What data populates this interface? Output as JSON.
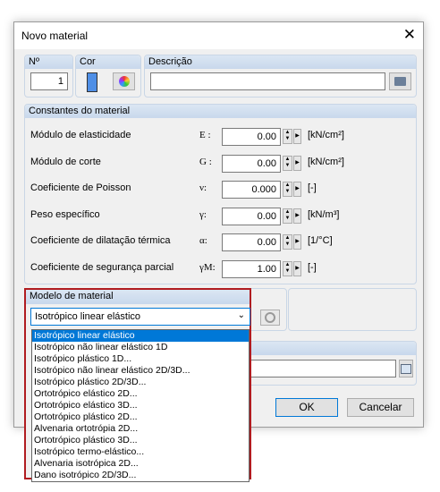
{
  "dialog": {
    "title": "Novo material"
  },
  "top": {
    "no_label": "Nº",
    "no_value": "1",
    "cor_label": "Cor",
    "color_swatch": "#4f8fe6",
    "desc_label": "Descrição"
  },
  "constants": {
    "header": "Constantes do material",
    "rows": [
      {
        "label": "Módulo de elasticidade",
        "symbol": "E :",
        "value": "0.00",
        "unit": "[kN/cm²]"
      },
      {
        "label": "Módulo de corte",
        "symbol": "G :",
        "value": "0.00",
        "unit": "[kN/cm²]"
      },
      {
        "label": "Coeficiente de Poisson",
        "symbol": "ν:",
        "value": "0.000",
        "unit": "[-]"
      },
      {
        "label": "Peso específico",
        "symbol": "γ:",
        "value": "0.00",
        "unit": "[kN/m³]"
      },
      {
        "label": "Coeficiente de dilatação térmica",
        "symbol": "α:",
        "value": "0.00",
        "unit": "[1/°C]"
      },
      {
        "label": "Coeficiente de segurança parcial",
        "symbol": "γM:",
        "value": "1.00",
        "unit": "[-]"
      }
    ]
  },
  "model": {
    "header": "Modelo de material",
    "selected": "Isotrópico linear elástico",
    "options": [
      "Isotrópico linear elástico",
      "Isotrópico não linear elástico 1D",
      "Isotrópico plástico 1D...",
      "Isotrópico não linear elástico 2D/3D...",
      "Isotrópico plástico 2D/3D...",
      "Ortotrópico elástico 2D...",
      "Ortotrópico elástico 3D...",
      "Ortotrópico plástico 2D...",
      "Alvenaria ortotrópia 2D...",
      "Ortotrópico plástico 3D...",
      "Isotrópico termo-elástico...",
      "Alvenaria isotrópica 2D...",
      "Dano isotrópico 2D/3D..."
    ]
  },
  "buttons": {
    "ok": "OK",
    "cancel": "Cancelar"
  }
}
